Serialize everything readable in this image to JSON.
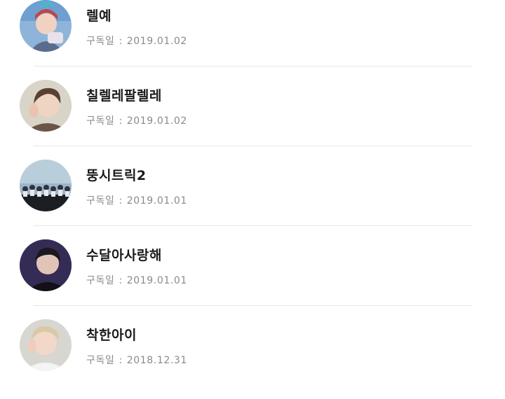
{
  "subscribers": [
    {
      "name": "렐예",
      "date_label": "구독일",
      "date": "2019.01.02",
      "avatar": "avatar-1"
    },
    {
      "name": "칠렐레팔렐레",
      "date_label": "구독일",
      "date": "2019.01.02",
      "avatar": "avatar-2"
    },
    {
      "name": "뚱시트릭2",
      "date_label": "구독일",
      "date": "2019.01.01",
      "avatar": "avatar-3"
    },
    {
      "name": "수달아사랑해",
      "date_label": "구독일",
      "date": "2019.01.01",
      "avatar": "avatar-4"
    },
    {
      "name": "착한아이",
      "date_label": "구독일",
      "date": "2018.12.31",
      "avatar": "avatar-5"
    }
  ],
  "separator": ":"
}
